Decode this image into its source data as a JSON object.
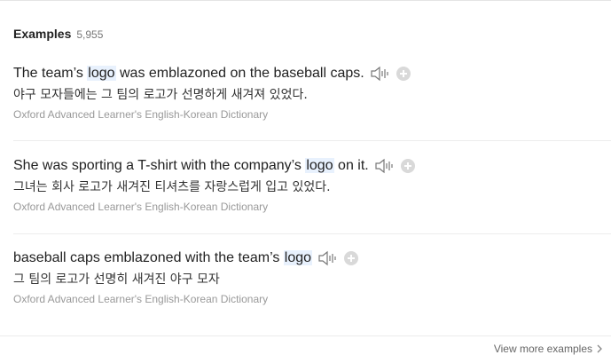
{
  "header": {
    "title": "Examples",
    "count": "5,955"
  },
  "examples": [
    {
      "pre": "The team’s ",
      "highlight": "logo",
      "post": " was emblazoned on the baseball caps.",
      "korean": "야구 모자들에는 그 팀의 로고가 선명하게 새겨져 있었다.",
      "source": "Oxford Advanced Learner's English-Korean Dictionary"
    },
    {
      "pre": "She was sporting a T-shirt with the company’s ",
      "highlight": "logo",
      "post": " on it.",
      "korean": "그녀는 회사 로고가 새겨진 티셔츠를 자랑스럽게 입고 있었다.",
      "source": "Oxford Advanced Learner's English-Korean Dictionary"
    },
    {
      "pre": "baseball caps emblazoned with the team’s ",
      "highlight": "logo",
      "post": "",
      "korean": "그 팀의 로고가 선명히 새겨진 야구 모자",
      "source": "Oxford Advanced Learner's English-Korean Dictionary"
    }
  ],
  "footer": {
    "view_more": "View more examples"
  },
  "icons": {
    "speaker": "speaker-icon",
    "add": "plus-circle-icon",
    "chevron": "chevron-right-icon"
  },
  "colors": {
    "highlight_bg": "#e8f1fd",
    "source_text": "#999999",
    "add_button": "#d9d9d9"
  }
}
